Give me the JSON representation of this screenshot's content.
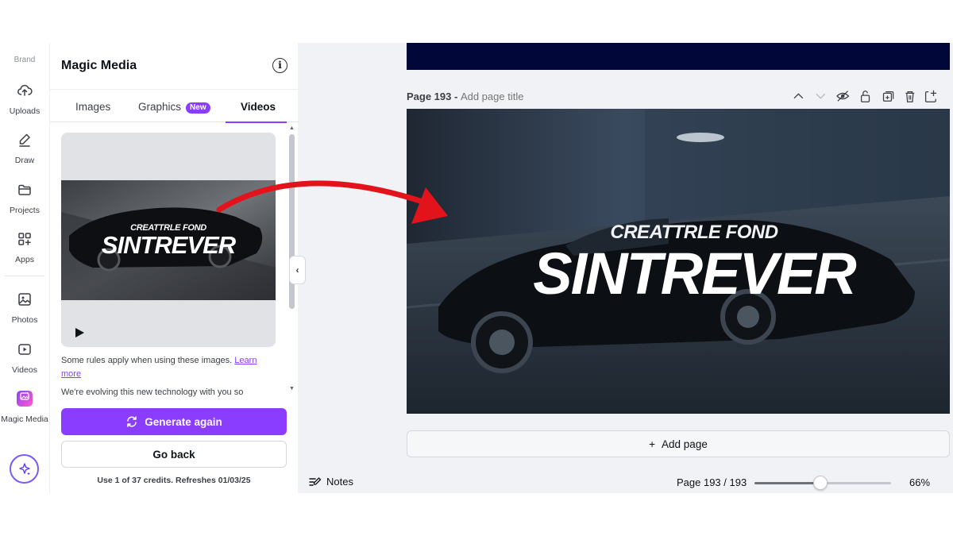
{
  "rail": {
    "brand": "Brand",
    "items": [
      {
        "label": "Uploads",
        "icon": "upload-cloud-icon"
      },
      {
        "label": "Draw",
        "icon": "pen-icon"
      },
      {
        "label": "Projects",
        "icon": "folder-icon"
      },
      {
        "label": "Apps",
        "icon": "apps-grid-icon"
      },
      {
        "label": "Photos",
        "icon": "image-icon"
      },
      {
        "label": "Videos",
        "icon": "video-play-icon"
      },
      {
        "label": "Magic Media",
        "icon": "magic-media-icon"
      }
    ]
  },
  "panel": {
    "title": "Magic Media",
    "tabs": [
      {
        "label": "Images",
        "active": false
      },
      {
        "label": "Graphics",
        "active": false,
        "badge": "New"
      },
      {
        "label": "Videos",
        "active": true
      }
    ],
    "preview": {
      "title_small": "CREATTRLE FOND",
      "title_big": "SINTREVER"
    },
    "rules_text": "Some rules apply when using these images. ",
    "rules_link": "Learn more",
    "evolving_text": "We're evolving this new technology with you so",
    "generate_label": "Generate again",
    "back_label": "Go back",
    "credits": "Use 1 of 37 credits. Refreshes 01/03/25"
  },
  "editor": {
    "page_number": "Page 193",
    "page_separator": " - ",
    "page_title_placeholder": "Add page title",
    "canvas_title_small": "CREATTRLE FOND",
    "canvas_title_big": "SINTREVER",
    "add_page_label": "Add page",
    "notes_label": "Notes",
    "page_count": "Page 193 / 193",
    "zoom": "66%",
    "zoom_fraction": 0.48
  },
  "colors": {
    "accent": "#8b3dff",
    "arrow": "#e3131b",
    "prev_page": "#02073a"
  }
}
